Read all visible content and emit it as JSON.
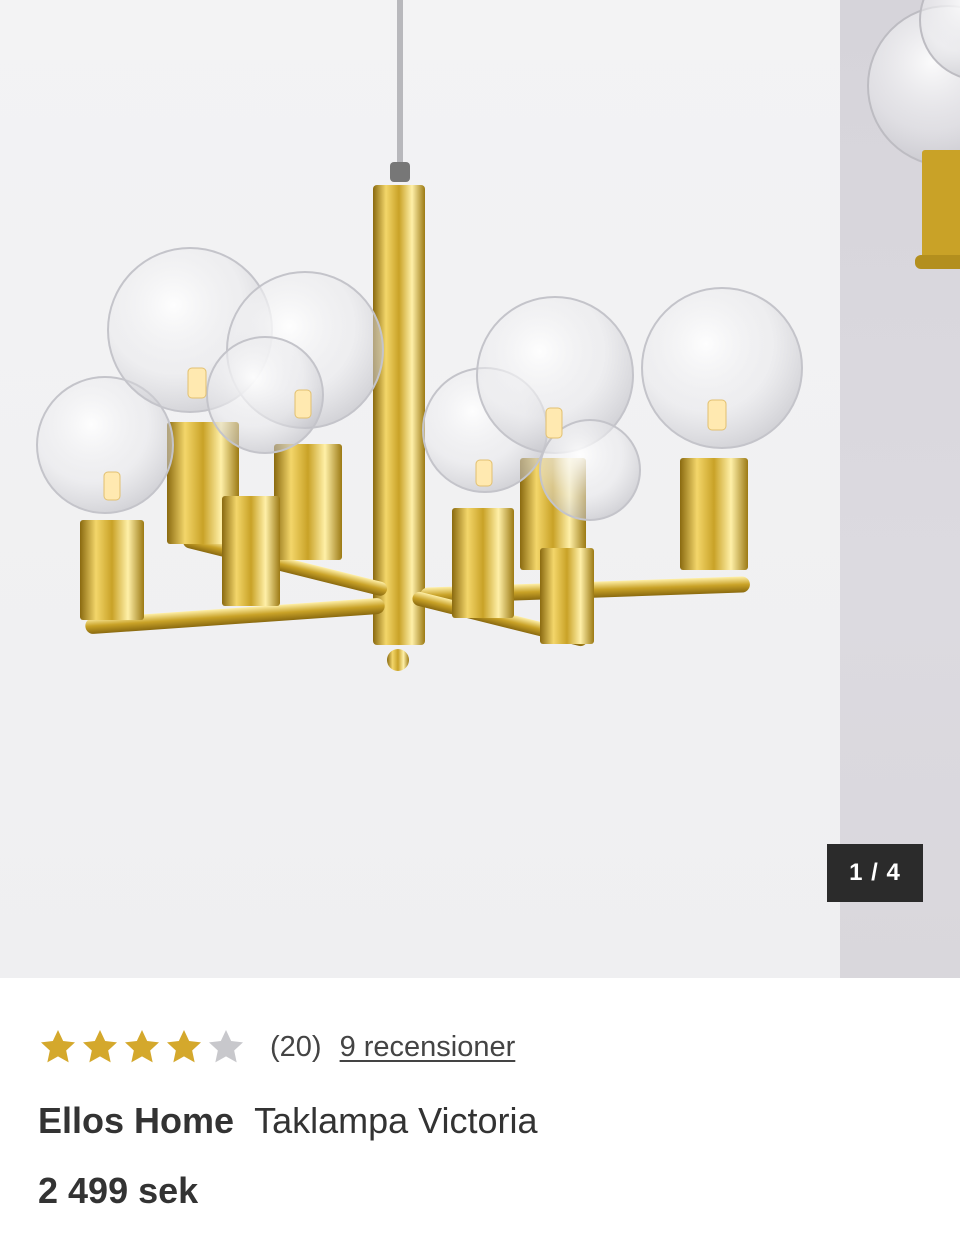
{
  "gallery": {
    "counter": "1 / 4",
    "image_alt": "Taklampa Victoria",
    "accent_gold": "#c9a227"
  },
  "product": {
    "rating": 4,
    "rating_max": 5,
    "rating_count": "(20)",
    "reviews_link": "9 recensioner",
    "brand": "Ellos Home",
    "name": "Taklampa Victoria",
    "price": "2 499 sek",
    "star_color": "#d4a82c",
    "star_empty_color": "#c8c8cc"
  }
}
